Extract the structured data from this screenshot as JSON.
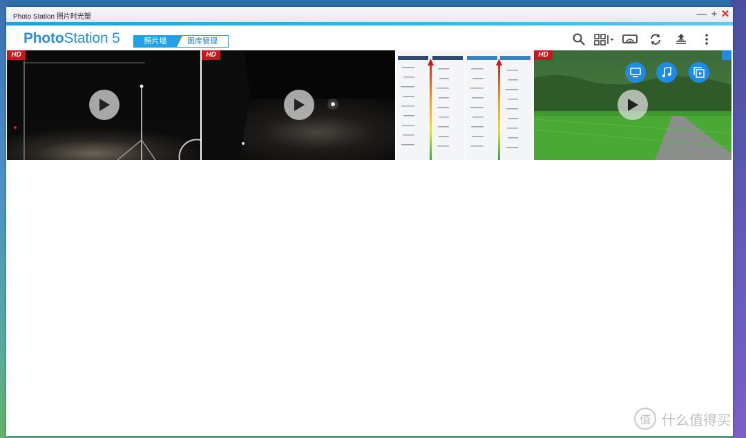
{
  "window": {
    "title": "Photo Station 照片时光塑",
    "minimize_glyph": "—",
    "maximize_glyph": "+",
    "close_glyph": "✕"
  },
  "brand": {
    "bold": "Photo",
    "regular": "Station 5"
  },
  "view_tabs": [
    {
      "label": "照片墙",
      "active": true
    },
    {
      "label": "图库管理",
      "active": false
    }
  ],
  "toolbar": {
    "icons": [
      "search-icon",
      "grid-view-icon",
      "cast-icon",
      "refresh-icon",
      "upload-icon",
      "more-icon"
    ]
  },
  "media": [
    {
      "type": "video",
      "badge": "HD",
      "scene": "night-tripod"
    },
    {
      "type": "video",
      "badge": "HD",
      "scene": "night-road"
    },
    {
      "type": "image",
      "scene": "gpu-chart"
    },
    {
      "type": "video",
      "badge": "HD",
      "scene": "field-road",
      "hover_actions": [
        "tv-icon",
        "music-icon",
        "slideshow-icon"
      ]
    }
  ],
  "watermark": {
    "icon": "值",
    "text": "什么值得买"
  },
  "colors": {
    "accent": "#1fa3e6",
    "brand": "#2b8fd1",
    "hd_badge": "#c8161e",
    "close": "#d9262a"
  }
}
